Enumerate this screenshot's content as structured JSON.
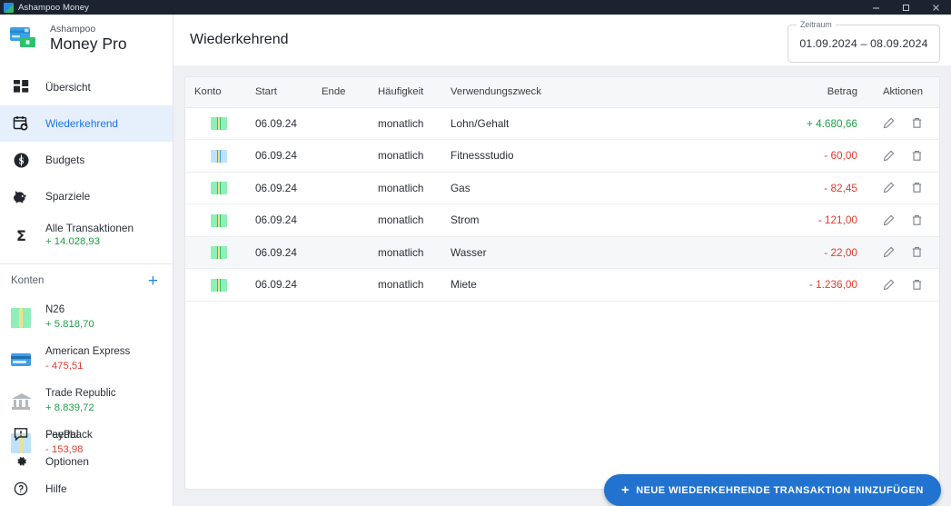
{
  "titlebar": {
    "title": "Ashampoo Money",
    "app_icon": "app-logo-icon",
    "minimize": "minimize-icon",
    "maximize": "maximize-icon",
    "close": "close-icon"
  },
  "brand": {
    "sub": "Ashampoo",
    "main": "Money Pro"
  },
  "sidebar": {
    "nav": [
      {
        "label": "Übersicht",
        "icon": "dashboard-icon",
        "active": false,
        "amount": ""
      },
      {
        "label": "Wiederkehrend",
        "icon": "recurring-icon",
        "active": true,
        "amount": ""
      },
      {
        "label": "Budgets",
        "icon": "budget-coin-icon",
        "active": false,
        "amount": ""
      },
      {
        "label": "Sparziele",
        "icon": "piggy-bank-icon",
        "active": false,
        "amount": ""
      },
      {
        "label": "Alle Transaktionen",
        "icon": "sigma-icon",
        "active": false,
        "amount": "+ 14.028,93",
        "amount_sign": "pos"
      }
    ],
    "accounts_header": {
      "label": "Konten",
      "add_icon": "plus-icon",
      "add_label": "+"
    },
    "accounts": [
      {
        "name": "N26",
        "amount": "+ 5.818,70",
        "amount_sign": "pos",
        "icon": "banknote-green-icon"
      },
      {
        "name": "American Express",
        "amount": "- 475,51",
        "amount_sign": "neg",
        "icon": "credit-card-blue-icon"
      },
      {
        "name": "Trade Republic",
        "amount": "+ 8.839,72",
        "amount_sign": "pos",
        "icon": "bank-building-icon"
      },
      {
        "name": "PayPal",
        "amount": "- 153,98",
        "amount_sign": "neg",
        "icon": "banknote-blue-icon"
      }
    ],
    "bottom_nav": [
      {
        "label": "Feedback",
        "icon": "feedback-icon"
      },
      {
        "label": "Optionen",
        "icon": "gear-icon"
      },
      {
        "label": "Hilfe",
        "icon": "help-circle-icon"
      }
    ]
  },
  "header": {
    "page_title": "Wiederkehrend",
    "date_range": {
      "legend": "Zeitraum",
      "value": "01.09.2024 – 08.09.2024"
    }
  },
  "table": {
    "columns": [
      "Konto",
      "Start",
      "Ende",
      "Häufigkeit",
      "Verwendungszweck",
      "Betrag",
      "Aktionen"
    ],
    "rows": [
      {
        "account_icon": "banknote-green-icon",
        "start": "06.09.24",
        "end": "",
        "frequency": "monatlich",
        "purpose": "Lohn/Gehalt",
        "amount": "+ 4.680,66",
        "amount_sign": "pos",
        "highlight": false
      },
      {
        "account_icon": "banknote-blue-icon",
        "start": "06.09.24",
        "end": "",
        "frequency": "monatlich",
        "purpose": "Fitnessstudio",
        "amount": "- 60,00",
        "amount_sign": "neg",
        "highlight": false
      },
      {
        "account_icon": "banknote-green-icon",
        "start": "06.09.24",
        "end": "",
        "frequency": "monatlich",
        "purpose": "Gas",
        "amount": "- 82,45",
        "amount_sign": "neg",
        "highlight": false
      },
      {
        "account_icon": "banknote-green-icon",
        "start": "06.09.24",
        "end": "",
        "frequency": "monatlich",
        "purpose": "Strom",
        "amount": "- 121,00",
        "amount_sign": "neg",
        "highlight": false
      },
      {
        "account_icon": "banknote-green-icon",
        "start": "06.09.24",
        "end": "",
        "frequency": "monatlich",
        "purpose": "Wasser",
        "amount": "- 22,00",
        "amount_sign": "neg",
        "highlight": true
      },
      {
        "account_icon": "banknote-green-icon",
        "start": "06.09.24",
        "end": "",
        "frequency": "monatlich",
        "purpose": "Miete",
        "amount": "- 1.236,00",
        "amount_sign": "neg",
        "highlight": false
      }
    ],
    "row_actions": {
      "edit_icon": "pencil-icon",
      "delete_icon": "trash-icon"
    }
  },
  "fab": {
    "plus": "+",
    "label": "NEUE WIEDERKEHRENDE TRANSAKTION HINZUFÜGEN"
  },
  "colors": {
    "accent": "#1a73e8",
    "fab": "#2173cf",
    "positive": "#1e9e47",
    "negative": "#e23b2e",
    "titlebar": "#1b2330",
    "main_bg": "#eef0f3",
    "active_nav_bg": "#e6f0fd"
  }
}
